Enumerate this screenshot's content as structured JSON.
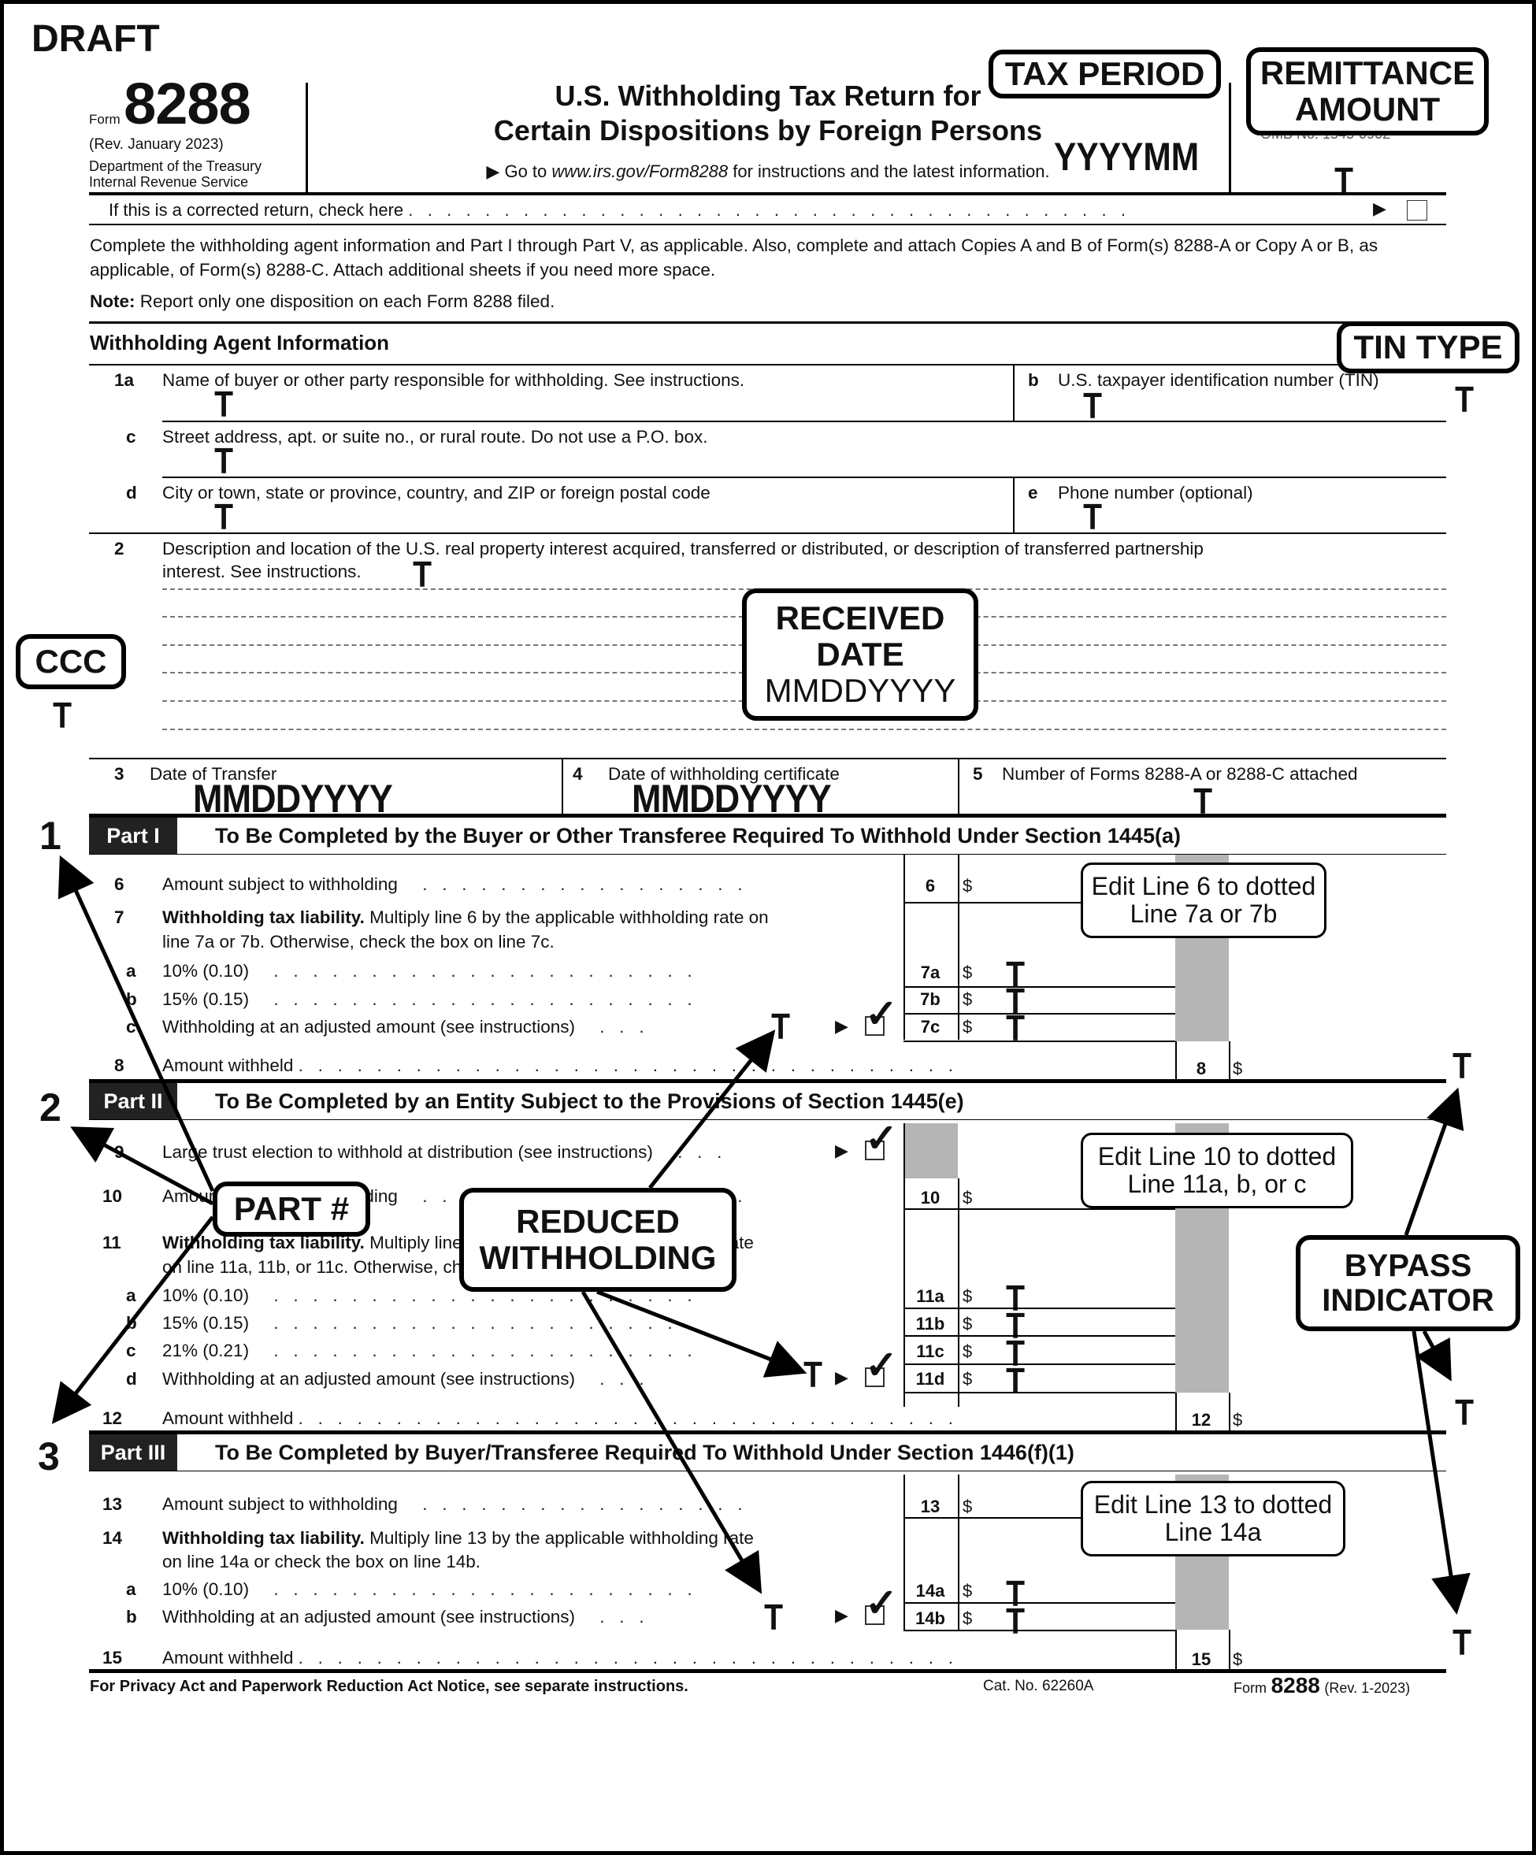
{
  "draft_label": "DRAFT",
  "header": {
    "form_label": "Form",
    "form_number": "8288",
    "revision": "(Rev. January 2023)",
    "department": "Department of the Treasury",
    "agency": "Internal Revenue Service",
    "title_line1": "U.S. Withholding Tax Return for",
    "title_line2": "Certain Dispositions by Foreign Persons",
    "goto_prefix": "▶ Go to ",
    "goto_url": "www.irs.gov/Form8288",
    "goto_suffix": " for instructions and the latest information.",
    "omb": "OMB No. 1545-0902",
    "corrected_label": "If this is a corrected return, check here",
    "corrected_checked": false
  },
  "intro": {
    "paragraph": "Complete the withholding agent information and Part I through Part V, as applicable. Also, complete and attach Copies A and B of Form(s) 8288-A or Copy A or B, as applicable, of Form(s) 8288-C. Attach additional sheets if you need more space.",
    "note_label": "Note:",
    "note_text": " Report only one disposition on each Form 8288 filed."
  },
  "agent_section": {
    "heading": "Withholding Agent Information",
    "lines": [
      {
        "num": "1a",
        "label": "Name of buyer or other party responsible for withholding. See instructions."
      },
      {
        "num": "b",
        "label": "U.S. taxpayer identification number (TIN)"
      },
      {
        "num": "c",
        "label": "Street address, apt. or suite no., or rural route. Do not use a P.O. box."
      },
      {
        "num": "d",
        "label": "City or town, state or province, country, and ZIP or foreign postal code"
      },
      {
        "num": "e",
        "label": "Phone number (optional)"
      },
      {
        "num": "2",
        "label": "Description and location of the U.S. real property interest acquired, transferred or distributed, or description of transferred partnership",
        "label2": "interest. See instructions."
      },
      {
        "num": "3",
        "label": "Date of Transfer",
        "value": "MMDDYYYY"
      },
      {
        "num": "4",
        "label": "Date of withholding certificate",
        "value": "MMDDYYYY"
      },
      {
        "num": "5",
        "label": "Number of Forms 8288-A or 8288-C attached"
      }
    ]
  },
  "part1": {
    "label": "Part I",
    "title": "To Be Completed by the Buyer or Other Transferee Required To Withhold Under Section 1445(a)",
    "lines": [
      {
        "num": "6",
        "label": "Amount subject to withholding",
        "box": "6"
      },
      {
        "num": "7",
        "bold": "Withholding tax liability.",
        "label": " Multiply line 6 by the applicable withholding rate on",
        "label2": "line 7a or 7b. Otherwise, check the box on line 7c."
      },
      {
        "num": "a",
        "label": "10% (0.10)",
        "box": "7a"
      },
      {
        "num": "b",
        "label": "15% (0.15)",
        "box": "7b"
      },
      {
        "num": "c",
        "label": "Withholding at an adjusted amount (see instructions)",
        "box": "7c",
        "checked": true
      },
      {
        "num": "8",
        "label": "Amount withheld",
        "box": "8"
      }
    ]
  },
  "part2": {
    "label": "Part II",
    "title": "To Be Completed by an Entity Subject to the Provisions of Section 1445(e)",
    "lines": [
      {
        "num": "9",
        "label": "Large trust election to withhold at distribution (see instructions)",
        "checked": true
      },
      {
        "num": "10",
        "label": "Amount subject to withholding",
        "box": "10"
      },
      {
        "num": "11",
        "bold": "Withholding tax liability.",
        "label": " Multiply line 10 by the applicable withholding rate",
        "label2": "on line 11a, 11b, or 11c. Otherwise, check the box on line 11d."
      },
      {
        "num": "a",
        "label": "10% (0.10)",
        "box": "11a"
      },
      {
        "num": "b",
        "label": "15% (0.15)",
        "box": "11b"
      },
      {
        "num": "c",
        "label": "21% (0.21)",
        "box": "11c"
      },
      {
        "num": "d",
        "label": "Withholding at an adjusted amount (see instructions)",
        "box": "11d",
        "checked": true
      },
      {
        "num": "12",
        "label": "Amount withheld",
        "box": "12"
      }
    ]
  },
  "part3": {
    "label": "Part III",
    "title": "To Be Completed by Buyer/Transferee Required To Withhold Under Section 1446(f)(1)",
    "lines": [
      {
        "num": "13",
        "label": "Amount subject to withholding",
        "box": "13"
      },
      {
        "num": "14",
        "bold": "Withholding tax liability.",
        "label": " Multiply line 13 by the applicable withholding rate",
        "label2": "on line 14a or check the box on line 14b."
      },
      {
        "num": "a",
        "label": "10% (0.10)",
        "box": "14a"
      },
      {
        "num": "b",
        "label": "Withholding at an adjusted amount (see instructions)",
        "box": "14b",
        "checked": true
      },
      {
        "num": "15",
        "label": "Amount withheld",
        "box": "15"
      }
    ]
  },
  "currency_symbol": "$",
  "field_marker": "T",
  "annotations": {
    "tax_period": "TAX PERIOD",
    "tax_period_format": "YYYYMM",
    "remittance": "REMITTANCE AMOUNT",
    "tin_type": "TIN TYPE",
    "ccc": "CCC",
    "received_date_l1": "RECEIVED",
    "received_date_l2": "DATE",
    "received_date_format": "MMDDYYYY",
    "part_num": "PART #",
    "reduced_l1": "REDUCED",
    "reduced_l2": "WITHHOLDING",
    "bypass_l1": "BYPASS",
    "bypass_l2": "INDICATOR",
    "edit6_l1": "Edit Line 6 to dotted",
    "edit6_l2": "Line 7a or 7b",
    "edit10_l1": "Edit Line 10 to dotted",
    "edit10_l2": "Line 11a, b, or c",
    "edit13_l1": "Edit Line 13 to dotted",
    "edit13_l2": "Line 14a",
    "part_numbers": [
      "1",
      "2",
      "3"
    ]
  },
  "footer": {
    "privacy": "For Privacy Act and Paperwork Reduction Act Notice, see separate instructions.",
    "cat_no": "Cat. No. 62260A",
    "form_label": "Form",
    "form_number": "8288",
    "rev": "(Rev. 1-2023)"
  }
}
